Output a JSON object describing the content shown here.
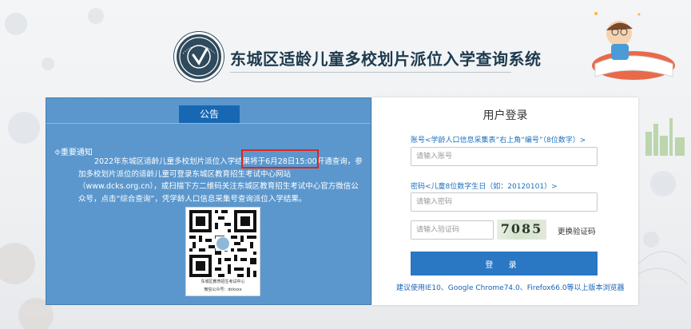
{
  "header": {
    "site_title": "东城区适龄儿童多校划片派位入学查询系统"
  },
  "notice": {
    "tab_label": "公告",
    "heading": "⯑重要通知",
    "body": "2022年东城区适龄儿童多校划片派位入学结果将于6月28日15:00开通查询，参加多校划片派位的适龄儿童可登录东城区教育招生考试中心网站（www.dcks.org.cn），或扫描下方二维码关注东城区教育招生考试中心官方微信公众号，点击“综合查询”，凭学龄人口信息采集号查询派位入学结果。",
    "qr_caption_line1": "东城区教育招生考试中心",
    "qr_caption_line2": "微信公众号：dcksxx"
  },
  "login": {
    "title": "用户登录",
    "account_label": "账号<学龄人口信息采集表”右上角“编号”（8位数字）>",
    "account_placeholder": "请输入账号",
    "account_value": "",
    "password_label": "密码<儿童8位数字生日（如：20120101）>",
    "password_placeholder": "请输入密码",
    "password_value": "",
    "captcha_placeholder": "请输入验证码",
    "captcha_value": "",
    "captcha_code": "7085",
    "refresh_captcha_label": "更换验证码",
    "submit_label": "登 录",
    "browser_tip": "建议使用IE10、Google Chrome74.0、Firefox66.0等以上版本浏览器"
  },
  "colors": {
    "notice_bg": "#5b97cd",
    "tab_bg": "#1767b3",
    "button_bg": "#2a77c3",
    "highlight": "#e3241b",
    "label_blue": "#1a6fc0"
  }
}
